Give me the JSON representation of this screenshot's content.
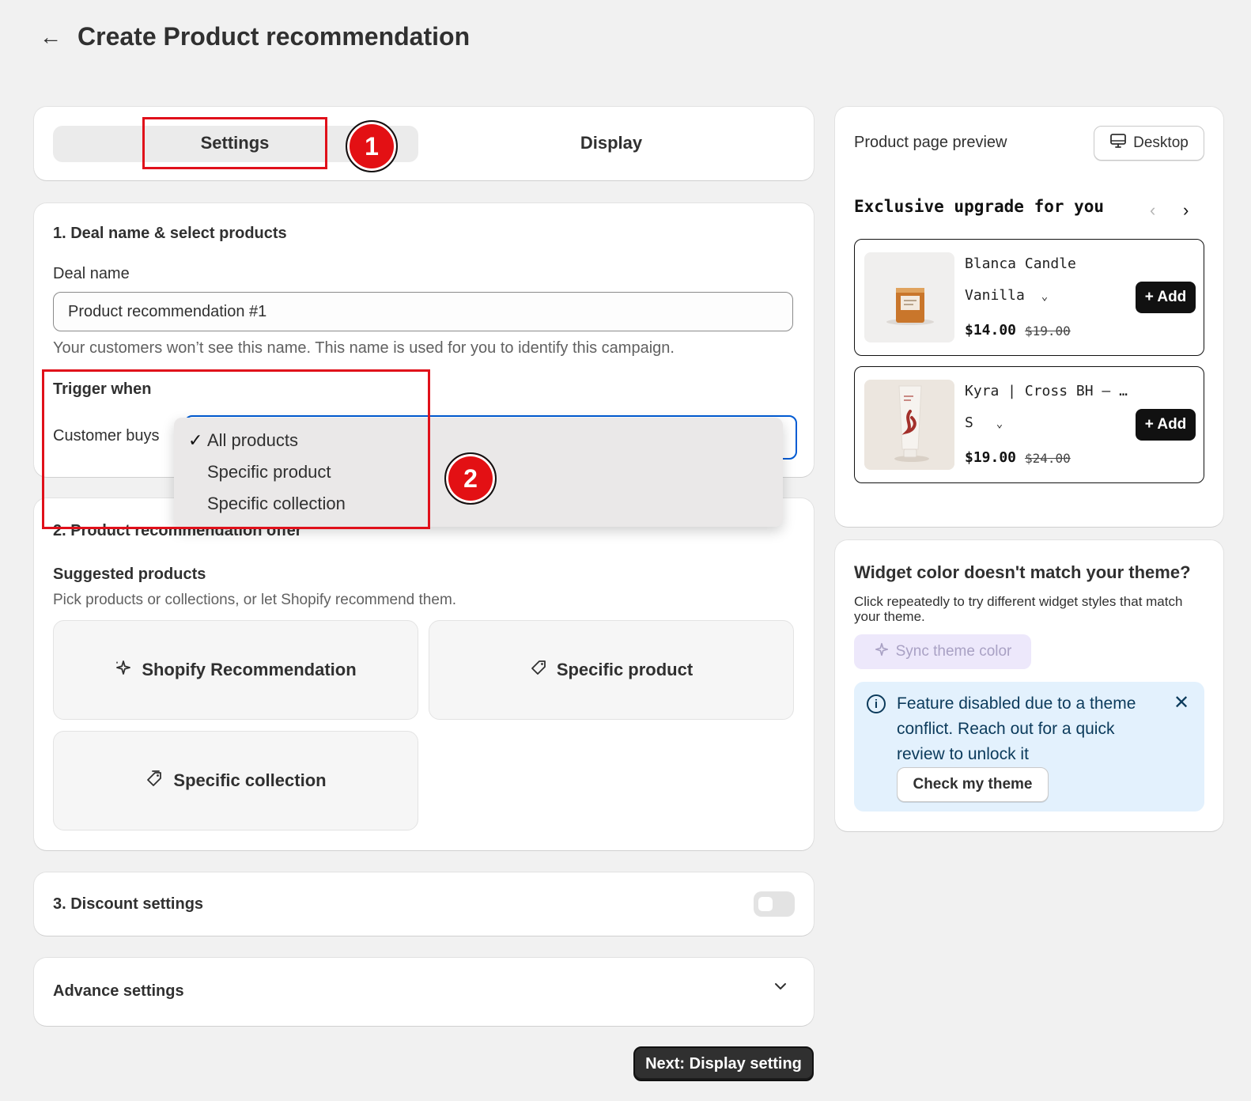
{
  "header": {
    "back_icon": "arrow-left-icon",
    "title": "Create Product recommendation"
  },
  "tabs": {
    "settings_label": "Settings",
    "display_label": "Display"
  },
  "annotations": {
    "badge_1": "1",
    "badge_2": "2",
    "highlight_color": "#e0101a"
  },
  "section1": {
    "title": "1. Deal name & select products",
    "deal_name_label": "Deal name",
    "deal_name_value": "Product recommendation #1",
    "help_text": "Your customers won’t see this name. This name is used for you to identify this campaign.",
    "trigger_title": "Trigger when",
    "customer_buys_label": "Customer buys",
    "dropdown": {
      "selected": "All products",
      "options": [
        "All products",
        "Specific product",
        "Specific collection"
      ]
    }
  },
  "section2": {
    "title": "2. Product recommendation offer",
    "suggested_title": "Suggested products",
    "suggested_help": "Pick products or collections, or let Shopify recommend them.",
    "tiles": [
      "Shopify Recommendation",
      "Specific product",
      "Specific collection"
    ]
  },
  "section3": {
    "title": "3. Discount settings",
    "toggle_on": false
  },
  "advance": {
    "title": "Advance settings"
  },
  "footer": {
    "next_label": "Next: Display setting"
  },
  "preview": {
    "title": "Product page preview",
    "device_label": "Desktop",
    "widget_title": "Exclusive upgrade for you",
    "products": [
      {
        "name": "Blanca Candle",
        "variant": "Vanilla",
        "price": "$14.00",
        "compare_price": "$19.00",
        "add_label": "+ Add"
      },
      {
        "name": "Kyra | Cross BH – …",
        "variant": "S",
        "price": "$19.00",
        "compare_price": "$24.00",
        "add_label": "+ Add"
      }
    ]
  },
  "widget_color": {
    "title": "Widget color doesn't match your theme?",
    "description": "Click repeatedly to try different widget styles that match your theme.",
    "sync_label": "Sync theme color",
    "banner_text": "Feature disabled due to a theme conflict. Reach out for a quick review to unlock it",
    "check_label": "Check my theme"
  },
  "colors": {
    "accent_blue": "#005bd3",
    "primary_dark": "#303030",
    "banner_bg": "#e3f1fd",
    "sync_bg": "#ede8fb"
  }
}
